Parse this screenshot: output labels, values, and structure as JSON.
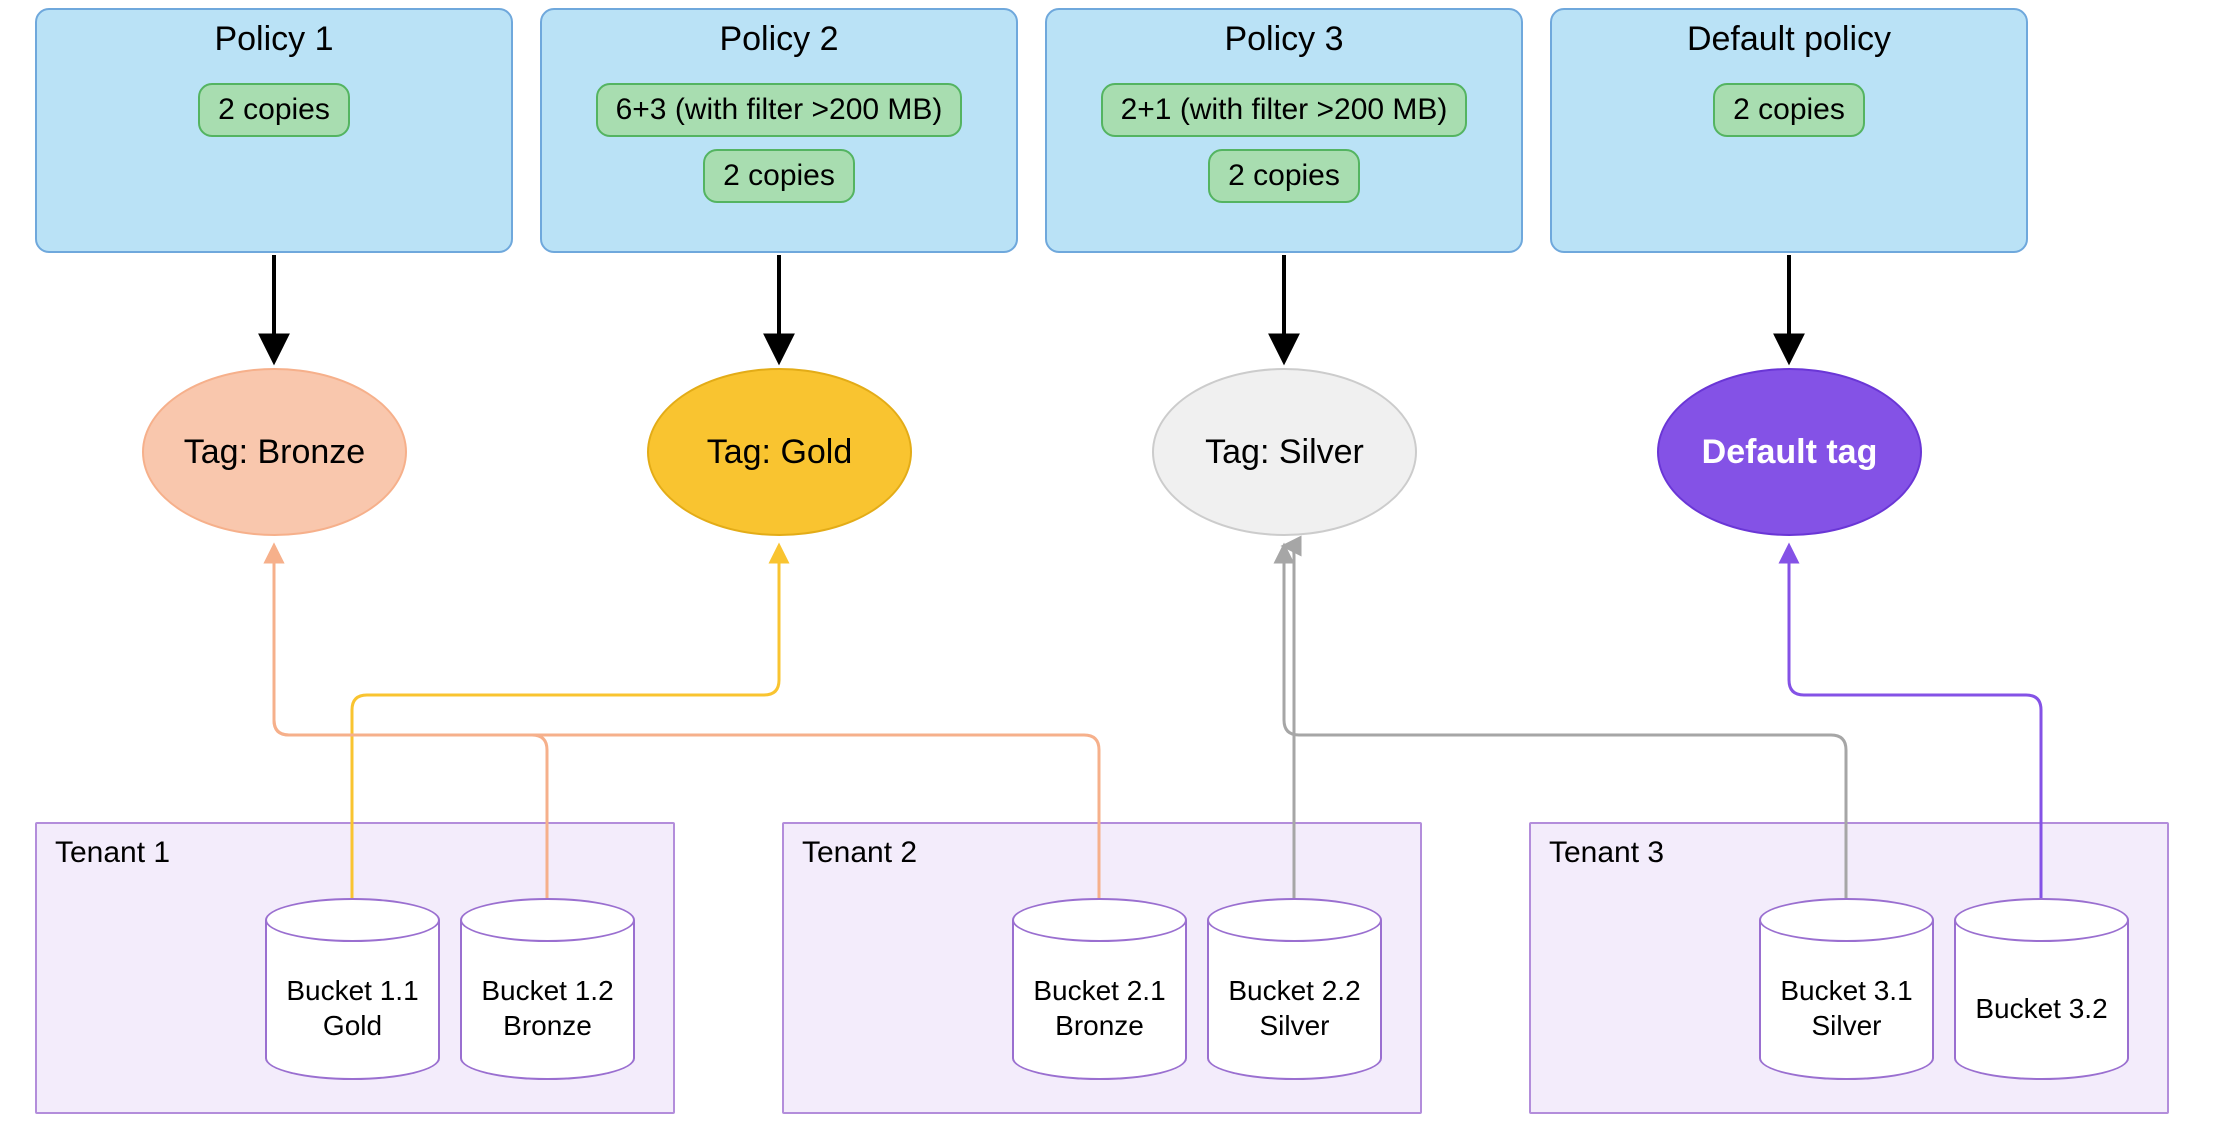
{
  "policies": [
    {
      "title": "Policy 1",
      "rules": [
        "2 copies"
      ]
    },
    {
      "title": "Policy 2",
      "rules": [
        "6+3 (with filter >200 MB)",
        "2 copies"
      ]
    },
    {
      "title": "Policy 3",
      "rules": [
        "2+1 (with filter >200 MB)",
        "2 copies"
      ]
    },
    {
      "title": "Default policy",
      "rules": [
        "2 copies"
      ]
    }
  ],
  "tags": [
    {
      "label": "Tag: Bronze",
      "fill": "#f9c7ad",
      "stroke": "#f6b08b",
      "textColor": "#000000",
      "bold": false
    },
    {
      "label": "Tag: Gold",
      "fill": "#f9c430",
      "stroke": "#e3ac17",
      "textColor": "#000000",
      "bold": false
    },
    {
      "label": "Tag: Silver",
      "fill": "#f0f0f0",
      "stroke": "#cccccc",
      "textColor": "#000000",
      "bold": false
    },
    {
      "label": "Default tag",
      "fill": "#8452e6",
      "stroke": "#6a36d6",
      "textColor": "#ffffff",
      "bold": true
    }
  ],
  "tenants": [
    {
      "label": "Tenant 1",
      "buckets": [
        {
          "name": "Bucket 1.1\nGold"
        },
        {
          "name": "Bucket 1.2\nBronze"
        }
      ]
    },
    {
      "label": "Tenant 2",
      "buckets": [
        {
          "name": "Bucket 2.1\nBronze"
        },
        {
          "name": "Bucket 2.2\nSilver"
        }
      ]
    },
    {
      "label": "Tenant 3",
      "buckets": [
        {
          "name": "Bucket 3.1\nSilver"
        },
        {
          "name": "Bucket 3.2"
        }
      ]
    }
  ],
  "connections": [
    {
      "from": "bucket-1-1",
      "to": "tag-gold",
      "color": "#f9c430"
    },
    {
      "from": "bucket-1-2",
      "to": "tag-bronze",
      "color": "#f6b08b"
    },
    {
      "from": "bucket-2-1",
      "to": "tag-bronze",
      "color": "#f6b08b"
    },
    {
      "from": "bucket-2-2",
      "to": "tag-silver",
      "color": "#a6a6a6"
    },
    {
      "from": "bucket-3-1",
      "to": "tag-silver",
      "color": "#a6a6a6"
    },
    {
      "from": "bucket-3-2",
      "to": "tag-default",
      "color": "#8452e6"
    }
  ]
}
